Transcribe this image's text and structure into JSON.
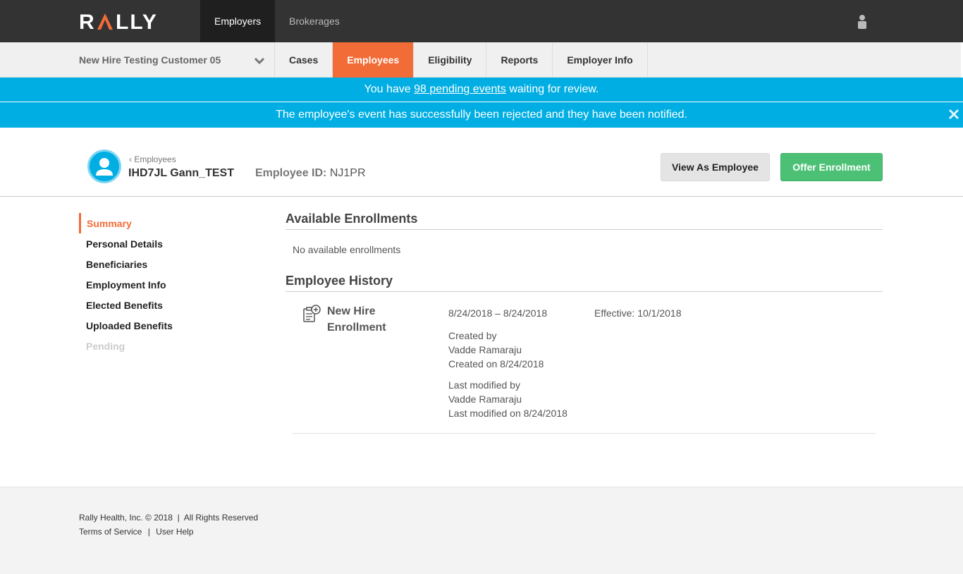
{
  "topbar": {
    "logo_text": "RALLY",
    "nav": [
      {
        "label": "Employers",
        "active": true
      },
      {
        "label": "Brokerages",
        "active": false
      }
    ],
    "user_icon": "user-icon"
  },
  "subnav": {
    "employer_name": "New Hire Testing Customer 05",
    "tabs": [
      {
        "label": "Cases",
        "active": false
      },
      {
        "label": "Employees",
        "active": true
      },
      {
        "label": "Eligibility",
        "active": false
      },
      {
        "label": "Reports",
        "active": false
      },
      {
        "label": "Employer Info",
        "active": false
      }
    ],
    "accent_color": "#f26c37"
  },
  "banners": {
    "pending_prefix": "You have ",
    "pending_link": "98 pending events",
    "pending_suffix": " waiting for review.",
    "rejection_message": "The employee's event has successfully been rejected and they have been notified.",
    "color": "#00aee3"
  },
  "employee": {
    "back_label": "Employees",
    "name": "IHD7JL Gann_TEST",
    "id_label": "Employee ID:",
    "id_value": "NJ1PR",
    "view_as_button": "View As Employee",
    "offer_button": "Offer Enrollment"
  },
  "sidenav": {
    "items": [
      {
        "label": "Summary",
        "state": "active"
      },
      {
        "label": "Personal Details",
        "state": "normal"
      },
      {
        "label": "Beneficiaries",
        "state": "normal"
      },
      {
        "label": "Employment Info",
        "state": "normal"
      },
      {
        "label": "Elected Benefits",
        "state": "normal"
      },
      {
        "label": "Uploaded Benefits",
        "state": "normal"
      },
      {
        "label": "Pending",
        "state": "disabled"
      }
    ]
  },
  "main": {
    "available_title": "Available Enrollments",
    "available_empty": "No available enrollments",
    "history_title": "Employee History",
    "history": [
      {
        "title": "New Hire Enrollment",
        "dates": "8/24/2018 – 8/24/2018",
        "effective": "Effective: 10/1/2018",
        "created_by_label": "Created by",
        "created_by": "Vadde Ramaraju",
        "created_on": "Created on 8/24/2018",
        "modified_by_label": "Last modified by",
        "modified_by": "Vadde Ramaraju",
        "modified_on": "Last modified on 8/24/2018"
      }
    ]
  },
  "footer": {
    "copyright": "Rally Health, Inc. © 2018  |  All Rights Reserved",
    "terms": "Terms of Service",
    "separator": "|",
    "help": "User Help"
  }
}
